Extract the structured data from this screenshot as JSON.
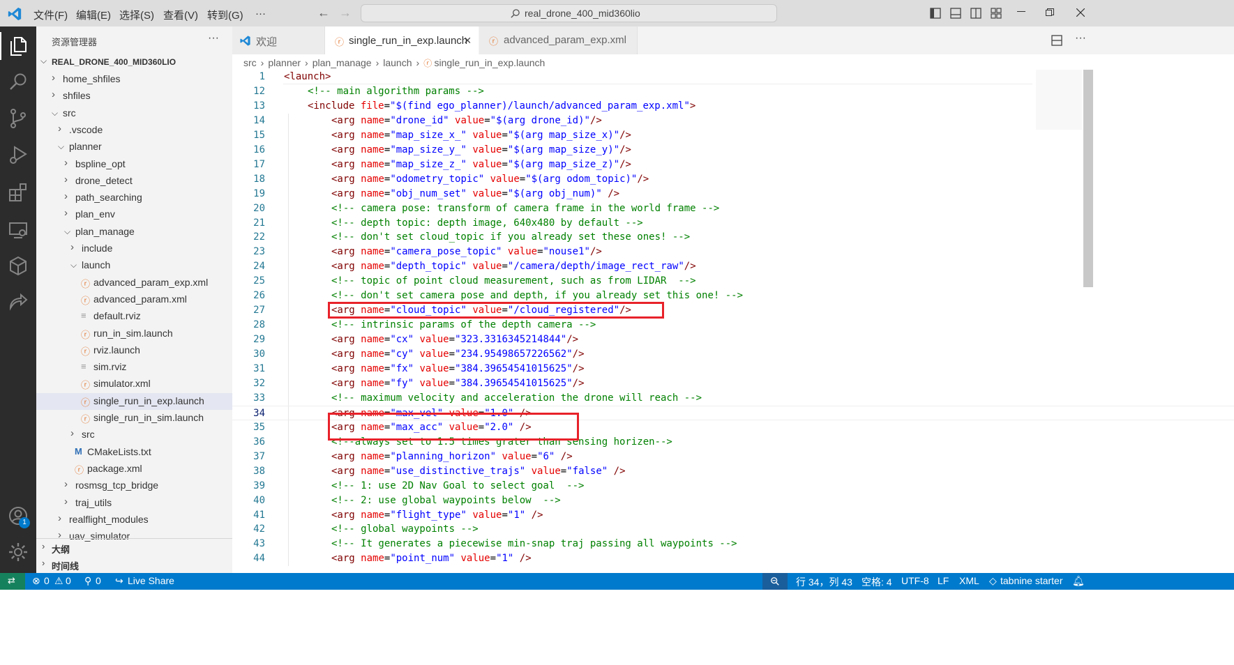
{
  "menu": [
    "文件(F)",
    "编辑(E)",
    "选择(S)",
    "查看(V)",
    "转到(G)",
    "···"
  ],
  "search_text": "real_drone_400_mid360lio",
  "explorer": {
    "title": "资源管理器",
    "more": "···",
    "root": "REAL_DRONE_400_MID360LIO",
    "items": [
      {
        "label": "home_shfiles",
        "indent": 0,
        "type": "folder",
        "open": false
      },
      {
        "label": "shfiles",
        "indent": 0,
        "type": "folder",
        "open": false
      },
      {
        "label": "src",
        "indent": 0,
        "type": "folder",
        "open": true
      },
      {
        "label": ".vscode",
        "indent": 1,
        "type": "folder",
        "open": false
      },
      {
        "label": "planner",
        "indent": 1,
        "type": "folder",
        "open": true
      },
      {
        "label": "bspline_opt",
        "indent": 2,
        "type": "folder",
        "open": false
      },
      {
        "label": "drone_detect",
        "indent": 2,
        "type": "folder",
        "open": false
      },
      {
        "label": "path_searching",
        "indent": 2,
        "type": "folder",
        "open": false
      },
      {
        "label": "plan_env",
        "indent": 2,
        "type": "folder",
        "open": false
      },
      {
        "label": "plan_manage",
        "indent": 2,
        "type": "folder",
        "open": true
      },
      {
        "label": "include",
        "indent": 3,
        "type": "folder",
        "open": false
      },
      {
        "label": "launch",
        "indent": 3,
        "type": "folder",
        "open": true
      },
      {
        "label": "advanced_param_exp.xml",
        "indent": 4,
        "type": "rss"
      },
      {
        "label": "advanced_param.xml",
        "indent": 4,
        "type": "rss"
      },
      {
        "label": "default.rviz",
        "indent": 4,
        "type": "lines"
      },
      {
        "label": "run_in_sim.launch",
        "indent": 4,
        "type": "rss"
      },
      {
        "label": "rviz.launch",
        "indent": 4,
        "type": "rss"
      },
      {
        "label": "sim.rviz",
        "indent": 4,
        "type": "lines"
      },
      {
        "label": "simulator.xml",
        "indent": 4,
        "type": "rss"
      },
      {
        "label": "single_run_in_exp.launch",
        "indent": 4,
        "type": "rss",
        "selected": true
      },
      {
        "label": "single_run_in_sim.launch",
        "indent": 4,
        "type": "rss"
      },
      {
        "label": "src",
        "indent": 3,
        "type": "folder",
        "open": false
      },
      {
        "label": "CMakeLists.txt",
        "indent": 3,
        "type": "cmake"
      },
      {
        "label": "package.xml",
        "indent": 3,
        "type": "rss"
      },
      {
        "label": "rosmsg_tcp_bridge",
        "indent": 2,
        "type": "folder",
        "open": false
      },
      {
        "label": "traj_utils",
        "indent": 2,
        "type": "folder",
        "open": false
      },
      {
        "label": "realflight_modules",
        "indent": 1,
        "type": "folder",
        "open": false
      },
      {
        "label": "uav_simulator",
        "indent": 1,
        "type": "folder",
        "open": false
      }
    ],
    "outline": "大纲",
    "timeline": "时间线"
  },
  "tabs": [
    {
      "label": "欢迎",
      "icon": "vscode-icon"
    },
    {
      "label": "single_run_in_exp.launch",
      "icon": "rss-icon",
      "active": true,
      "close": "×"
    },
    {
      "label": "advanced_param_exp.xml",
      "icon": "rss-icon"
    }
  ],
  "breadcrumb": [
    "src",
    "planner",
    "plan_manage",
    "launch",
    "single_run_in_exp.launch"
  ],
  "breadcrumb_sep": "›",
  "code_lines": [
    {
      "n": "1",
      "indent": 0,
      "tokens": [
        [
          "t",
          "<launch>"
        ]
      ]
    },
    {
      "n": "12",
      "indent": 1,
      "tokens": [
        [
          "c",
          "<!-- main algorithm params -->"
        ]
      ]
    },
    {
      "n": "13",
      "indent": 1,
      "tokens": [
        [
          "t",
          "<include "
        ],
        [
          "a",
          "file"
        ],
        [
          "x",
          "="
        ],
        [
          "v",
          "\"$(find ego_planner)/launch/advanced_param_exp.xml\""
        ],
        [
          "t",
          ">"
        ]
      ]
    },
    {
      "n": "14",
      "indent": 2,
      "tokens": [
        [
          "t",
          "<arg "
        ],
        [
          "a",
          "name"
        ],
        [
          "x",
          "="
        ],
        [
          "v",
          "\"drone_id\""
        ],
        [
          "x",
          " "
        ],
        [
          "a",
          "value"
        ],
        [
          "x",
          "="
        ],
        [
          "v",
          "\"$(arg drone_id)\""
        ],
        [
          "t",
          "/>"
        ]
      ]
    },
    {
      "n": "15",
      "indent": 2,
      "tokens": [
        [
          "t",
          "<arg "
        ],
        [
          "a",
          "name"
        ],
        [
          "x",
          "="
        ],
        [
          "v",
          "\"map_size_x_\""
        ],
        [
          "x",
          " "
        ],
        [
          "a",
          "value"
        ],
        [
          "x",
          "="
        ],
        [
          "v",
          "\"$(arg map_size_x)\""
        ],
        [
          "t",
          "/>"
        ]
      ]
    },
    {
      "n": "16",
      "indent": 2,
      "tokens": [
        [
          "t",
          "<arg "
        ],
        [
          "a",
          "name"
        ],
        [
          "x",
          "="
        ],
        [
          "v",
          "\"map_size_y_\""
        ],
        [
          "x",
          " "
        ],
        [
          "a",
          "value"
        ],
        [
          "x",
          "="
        ],
        [
          "v",
          "\"$(arg map_size_y)\""
        ],
        [
          "t",
          "/>"
        ]
      ]
    },
    {
      "n": "17",
      "indent": 2,
      "tokens": [
        [
          "t",
          "<arg "
        ],
        [
          "a",
          "name"
        ],
        [
          "x",
          "="
        ],
        [
          "v",
          "\"map_size_z_\""
        ],
        [
          "x",
          " "
        ],
        [
          "a",
          "value"
        ],
        [
          "x",
          "="
        ],
        [
          "v",
          "\"$(arg map_size_z)\""
        ],
        [
          "t",
          "/>"
        ]
      ]
    },
    {
      "n": "18",
      "indent": 2,
      "tokens": [
        [
          "t",
          "<arg "
        ],
        [
          "a",
          "name"
        ],
        [
          "x",
          "="
        ],
        [
          "v",
          "\"odometry_topic\""
        ],
        [
          "x",
          " "
        ],
        [
          "a",
          "value"
        ],
        [
          "x",
          "="
        ],
        [
          "v",
          "\"$(arg odom_topic)\""
        ],
        [
          "t",
          "/>"
        ]
      ]
    },
    {
      "n": "19",
      "indent": 2,
      "tokens": [
        [
          "t",
          "<arg "
        ],
        [
          "a",
          "name"
        ],
        [
          "x",
          "="
        ],
        [
          "v",
          "\"obj_num_set\""
        ],
        [
          "x",
          " "
        ],
        [
          "a",
          "value"
        ],
        [
          "x",
          "="
        ],
        [
          "v",
          "\"$(arg obj_num)\""
        ],
        [
          "x",
          " "
        ],
        [
          "t",
          "/>"
        ]
      ]
    },
    {
      "n": "20",
      "indent": 2,
      "tokens": [
        [
          "c",
          "<!-- camera pose: transform of camera frame in the world frame -->"
        ]
      ]
    },
    {
      "n": "21",
      "indent": 2,
      "tokens": [
        [
          "c",
          "<!-- depth topic: depth image, 640x480 by default -->"
        ]
      ]
    },
    {
      "n": "22",
      "indent": 2,
      "tokens": [
        [
          "c",
          "<!-- don't set cloud_topic if you already set these ones! -->"
        ]
      ]
    },
    {
      "n": "23",
      "indent": 2,
      "tokens": [
        [
          "t",
          "<arg "
        ],
        [
          "a",
          "name"
        ],
        [
          "x",
          "="
        ],
        [
          "v",
          "\"camera_pose_topic\""
        ],
        [
          "x",
          " "
        ],
        [
          "a",
          "value"
        ],
        [
          "x",
          "="
        ],
        [
          "v",
          "\"nouse1\""
        ],
        [
          "t",
          "/>"
        ]
      ]
    },
    {
      "n": "24",
      "indent": 2,
      "tokens": [
        [
          "t",
          "<arg "
        ],
        [
          "a",
          "name"
        ],
        [
          "x",
          "="
        ],
        [
          "v",
          "\"depth_topic\""
        ],
        [
          "x",
          " "
        ],
        [
          "a",
          "value"
        ],
        [
          "x",
          "="
        ],
        [
          "v",
          "\"/camera/depth/image_rect_raw\""
        ],
        [
          "t",
          "/>"
        ]
      ]
    },
    {
      "n": "25",
      "indent": 2,
      "tokens": [
        [
          "c",
          "<!-- topic of point cloud measurement, such as from LIDAR  -->"
        ]
      ]
    },
    {
      "n": "26",
      "indent": 2,
      "tokens": [
        [
          "c",
          "<!-- don't set camera pose and depth, if you already set this one! -->"
        ]
      ]
    },
    {
      "n": "27",
      "indent": 2,
      "tokens": [
        [
          "t",
          "<arg "
        ],
        [
          "a",
          "name"
        ],
        [
          "x",
          "="
        ],
        [
          "v",
          "\"cloud_topic\""
        ],
        [
          "x",
          " "
        ],
        [
          "a",
          "value"
        ],
        [
          "x",
          "="
        ],
        [
          "v",
          "\"/cloud_registered\""
        ],
        [
          "t",
          "/>"
        ]
      ]
    },
    {
      "n": "28",
      "indent": 2,
      "tokens": [
        [
          "c",
          "<!-- intrinsic params of the depth camera -->"
        ]
      ]
    },
    {
      "n": "29",
      "indent": 2,
      "tokens": [
        [
          "t",
          "<arg "
        ],
        [
          "a",
          "name"
        ],
        [
          "x",
          "="
        ],
        [
          "v",
          "\"cx\""
        ],
        [
          "x",
          " "
        ],
        [
          "a",
          "value"
        ],
        [
          "x",
          "="
        ],
        [
          "v",
          "\"323.3316345214844\""
        ],
        [
          "t",
          "/>"
        ]
      ]
    },
    {
      "n": "30",
      "indent": 2,
      "tokens": [
        [
          "t",
          "<arg "
        ],
        [
          "a",
          "name"
        ],
        [
          "x",
          "="
        ],
        [
          "v",
          "\"cy\""
        ],
        [
          "x",
          " "
        ],
        [
          "a",
          "value"
        ],
        [
          "x",
          "="
        ],
        [
          "v",
          "\"234.95498657226562\""
        ],
        [
          "t",
          "/>"
        ]
      ]
    },
    {
      "n": "31",
      "indent": 2,
      "tokens": [
        [
          "t",
          "<arg "
        ],
        [
          "a",
          "name"
        ],
        [
          "x",
          "="
        ],
        [
          "v",
          "\"fx\""
        ],
        [
          "x",
          " "
        ],
        [
          "a",
          "value"
        ],
        [
          "x",
          "="
        ],
        [
          "v",
          "\"384.39654541015625\""
        ],
        [
          "t",
          "/>"
        ]
      ]
    },
    {
      "n": "32",
      "indent": 2,
      "tokens": [
        [
          "t",
          "<arg "
        ],
        [
          "a",
          "name"
        ],
        [
          "x",
          "="
        ],
        [
          "v",
          "\"fy\""
        ],
        [
          "x",
          " "
        ],
        [
          "a",
          "value"
        ],
        [
          "x",
          "="
        ],
        [
          "v",
          "\"384.39654541015625\""
        ],
        [
          "t",
          "/>"
        ]
      ]
    },
    {
      "n": "33",
      "indent": 2,
      "tokens": [
        [
          "c",
          "<!-- maximum velocity and acceleration the drone will reach -->"
        ]
      ]
    },
    {
      "n": "34",
      "indent": 2,
      "active": true,
      "tokens": [
        [
          "t",
          "<arg "
        ],
        [
          "a",
          "name"
        ],
        [
          "x",
          "="
        ],
        [
          "v",
          "\"max_vel\""
        ],
        [
          "x",
          " "
        ],
        [
          "a",
          "value"
        ],
        [
          "x",
          "="
        ],
        [
          "v",
          "\"1.0\""
        ],
        [
          "x",
          " "
        ],
        [
          "t",
          "/>"
        ]
      ]
    },
    {
      "n": "35",
      "indent": 2,
      "tokens": [
        [
          "t",
          "<arg "
        ],
        [
          "a",
          "name"
        ],
        [
          "x",
          "="
        ],
        [
          "v",
          "\"max_acc\""
        ],
        [
          "x",
          " "
        ],
        [
          "a",
          "value"
        ],
        [
          "x",
          "="
        ],
        [
          "v",
          "\"2.0\""
        ],
        [
          "x",
          " "
        ],
        [
          "t",
          "/>"
        ]
      ]
    },
    {
      "n": "36",
      "indent": 2,
      "tokens": [
        [
          "c",
          "<!--always set to 1.5 times grater than sensing horizen-->"
        ]
      ]
    },
    {
      "n": "37",
      "indent": 2,
      "tokens": [
        [
          "t",
          "<arg "
        ],
        [
          "a",
          "name"
        ],
        [
          "x",
          "="
        ],
        [
          "v",
          "\"planning_horizon\""
        ],
        [
          "x",
          " "
        ],
        [
          "a",
          "value"
        ],
        [
          "x",
          "="
        ],
        [
          "v",
          "\"6\""
        ],
        [
          "x",
          " "
        ],
        [
          "t",
          "/>"
        ]
      ]
    },
    {
      "n": "38",
      "indent": 2,
      "tokens": [
        [
          "t",
          "<arg "
        ],
        [
          "a",
          "name"
        ],
        [
          "x",
          "="
        ],
        [
          "v",
          "\"use_distinctive_trajs\""
        ],
        [
          "x",
          " "
        ],
        [
          "a",
          "value"
        ],
        [
          "x",
          "="
        ],
        [
          "v",
          "\"false\""
        ],
        [
          "x",
          " "
        ],
        [
          "t",
          "/>"
        ]
      ]
    },
    {
      "n": "39",
      "indent": 2,
      "tokens": [
        [
          "c",
          "<!-- 1: use 2D Nav Goal to select goal  -->"
        ]
      ]
    },
    {
      "n": "40",
      "indent": 2,
      "tokens": [
        [
          "c",
          "<!-- 2: use global waypoints below  -->"
        ]
      ]
    },
    {
      "n": "41",
      "indent": 2,
      "tokens": [
        [
          "t",
          "<arg "
        ],
        [
          "a",
          "name"
        ],
        [
          "x",
          "="
        ],
        [
          "v",
          "\"flight_type\""
        ],
        [
          "x",
          " "
        ],
        [
          "a",
          "value"
        ],
        [
          "x",
          "="
        ],
        [
          "v",
          "\"1\""
        ],
        [
          "x",
          " "
        ],
        [
          "t",
          "/>"
        ]
      ]
    },
    {
      "n": "42",
      "indent": 2,
      "tokens": [
        [
          "c",
          "<!-- global waypoints -->"
        ]
      ]
    },
    {
      "n": "43",
      "indent": 2,
      "tokens": [
        [
          "c",
          "<!-- It generates a piecewise min-snap traj passing all waypoints -->"
        ]
      ]
    },
    {
      "n": "44",
      "indent": 2,
      "tokens": [
        [
          "t",
          "<arg "
        ],
        [
          "a",
          "name"
        ],
        [
          "x",
          "="
        ],
        [
          "v",
          "\"point_num\""
        ],
        [
          "x",
          " "
        ],
        [
          "a",
          "value"
        ],
        [
          "x",
          "="
        ],
        [
          "v",
          "\"1\""
        ],
        [
          "x",
          " "
        ],
        [
          "t",
          "/>"
        ]
      ]
    }
  ],
  "status": {
    "errors": "0",
    "warnings": "0",
    "ports": "0",
    "live_share": "Live Share",
    "position": "行 34，列 43",
    "spaces": "空格: 4",
    "encoding": "UTF-8",
    "eol": "LF",
    "language": "XML",
    "tabnine": "tabnine starter"
  },
  "accounts_badge": "1",
  "colors": {
    "accent": "#007acc",
    "highlight_box": "#e8222a",
    "rss": "#e37933"
  }
}
